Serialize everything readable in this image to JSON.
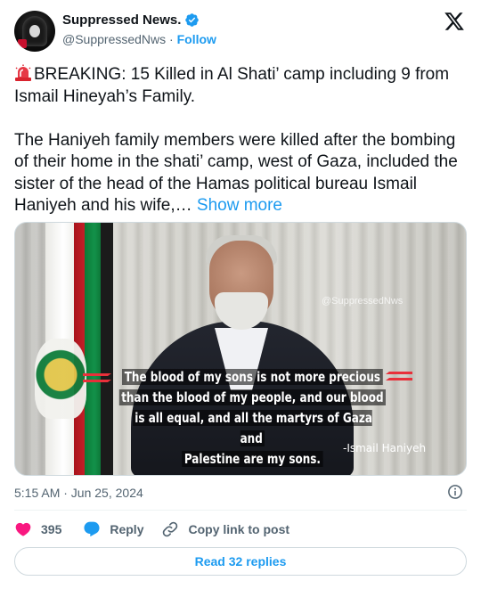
{
  "author": {
    "display_name": "Suppressed News.",
    "handle": "@SuppressedNws",
    "separator": "·",
    "follow_label": "Follow",
    "verified": true
  },
  "tweet": {
    "line1": "BREAKING: 15 Killed in Al Shati’ camp including 9 from Ismail Hineyah’s Family.",
    "line2": "The Haniyeh family members were killed after the bombing of their home in the shati’ camp, west of Gaza, included the sister of the head of the Hamas political bureau Ismail Haniyeh and his wife,… ",
    "show_more": "Show more",
    "leading_icon": "rotating-light-icon"
  },
  "media": {
    "watermark": "@SuppressedNws",
    "quote_lines": [
      "The blood of my sons is not more precious",
      "than the blood of my people, and our blood",
      "is all equal, and all the martyrs of Gaza and",
      "Palestine are my sons."
    ],
    "attribution": "-Ismail Haniyeh"
  },
  "timestamp": "5:15 AM · Jun 25, 2024",
  "actions": {
    "likes": "395",
    "reply_label": "Reply",
    "copy_link_label": "Copy link to post"
  },
  "read_replies_label": "Read 32 replies",
  "colors": {
    "accent": "#1d9bf0",
    "like": "#f91880",
    "text": "#0f1419",
    "muted": "#536471"
  }
}
